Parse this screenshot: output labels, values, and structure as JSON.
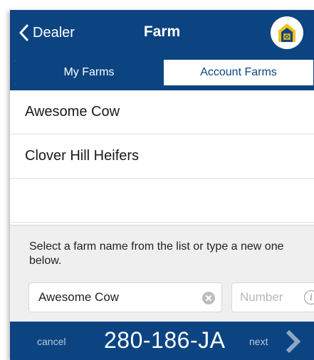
{
  "navbar": {
    "back_label": "Dealer",
    "title": "Farm",
    "back_icon": "chevron-left-icon",
    "logo_icon": "barn-logo-icon"
  },
  "segments": {
    "items": [
      {
        "label": "My Farms",
        "selected": true
      },
      {
        "label": "Account Farms",
        "selected": false
      }
    ]
  },
  "farm_list": {
    "items": [
      "Awesome Cow",
      "Clover Hill Heifers"
    ]
  },
  "entry": {
    "prompt": "Select a farm name from the list or type a new one below.",
    "name_value": "Awesome Cow",
    "number_placeholder": "Number",
    "clear_icon": "clear-icon",
    "info_icon": "info-icon",
    "info_glyph": "i"
  },
  "footer": {
    "cancel_label": "cancel",
    "tag_id": "280-186-JA",
    "next_label": "next",
    "next_icon": "chevron-right-icon"
  },
  "colors": {
    "primary": "#0c4482",
    "logo_yellow": "#f2c21b"
  }
}
